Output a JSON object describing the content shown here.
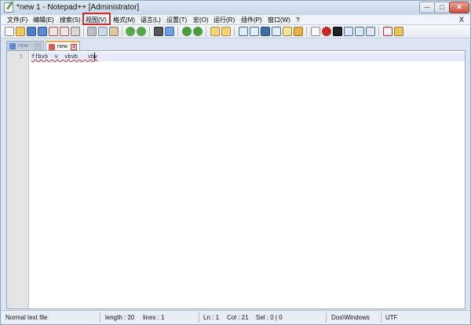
{
  "window": {
    "title": "*new  1 - Notepad++ [Administrator]",
    "min_label": "─",
    "max_label": "□",
    "close_label": "✕"
  },
  "menu": {
    "items": [
      {
        "label": "文件(F)"
      },
      {
        "label": "编辑(E)"
      },
      {
        "label": "搜索(S)"
      },
      {
        "label": "视图(V)"
      },
      {
        "label": "格式(M)"
      },
      {
        "label": "语言(L)"
      },
      {
        "label": "设置(T)"
      },
      {
        "label": "宏(O)"
      },
      {
        "label": "运行(R)"
      },
      {
        "label": "插件(P)"
      },
      {
        "label": "窗口(W)"
      },
      {
        "label": "?"
      }
    ],
    "close_doc_label": "X",
    "highlighted_item": "视图(V)",
    "highlight_color": "#d52b2b"
  },
  "toolbar": {
    "icons": [
      "new-file-icon",
      "open-file-icon",
      "save-icon",
      "save-all-icon",
      "close-icon",
      "close-all-icon",
      "print-icon",
      "cut-icon",
      "copy-icon",
      "paste-icon",
      "undo-icon",
      "redo-icon",
      "find-icon",
      "replace-icon",
      "zoom-in-icon",
      "zoom-out-icon",
      "sync-v-icon",
      "sync-h-icon",
      "wrap-icon",
      "show-all-chars-icon",
      "indent-guide-icon",
      "doc-map-icon",
      "function-list-icon",
      "folder-as-workspace-icon",
      "monitor-icon",
      "record-macro-icon",
      "stop-macro-icon",
      "play-macro-icon",
      "play-multi-icon",
      "save-macro-icon",
      "spellcheck-icon",
      "plugin-icon"
    ]
  },
  "tabs": [
    {
      "label": "new",
      "active": false
    },
    {
      "label": "new",
      "active": true
    }
  ],
  "editor": {
    "line_number": "1",
    "line_text": "ffbvb  v  vbvb   vbv"
  },
  "status": {
    "file_type": "Normal text file",
    "length": "length : 20",
    "lines": "lines : 1",
    "ln": "Ln : 1",
    "col": "Col : 21",
    "sel": "Sel : 0 | 0",
    "eol": "Dos\\Windows",
    "encoding": "UTF"
  },
  "colors": {
    "tab_active_accent": "#f3a64a",
    "current_line": "#e8e8ff",
    "spell_underline": "#d03030"
  }
}
